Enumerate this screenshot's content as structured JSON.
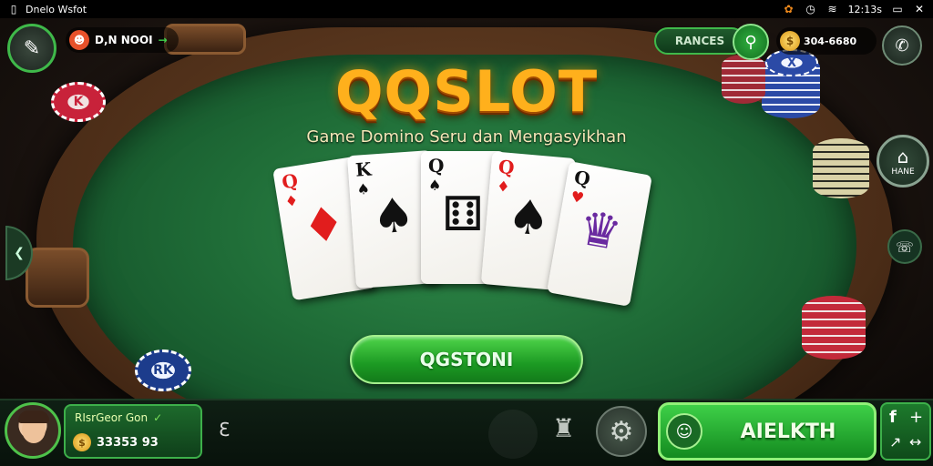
{
  "status_bar": {
    "app_title": "Dnelo Wsfot",
    "time": "12:13s"
  },
  "header": {
    "player_name": "D,N NOOI",
    "rank_label": "RANCES",
    "coins": "304-6680"
  },
  "logo": {
    "text": "QQSLOT",
    "tagline": "Game Domino Seru dan Mengasyikhan"
  },
  "cards": [
    {
      "rank": "Q",
      "suit": "♦",
      "color": "red"
    },
    {
      "rank": "K",
      "suit": "♠",
      "color": "black"
    },
    {
      "rank": "Q",
      "suit": "♠",
      "color": "black"
    },
    {
      "rank": "Q",
      "suit": "♠",
      "color": "red"
    },
    {
      "rank": "Q",
      "suit": "♥",
      "color": "red"
    }
  ],
  "chips": {
    "left_chip_label": "K",
    "bottom_chip_label": "RK",
    "right_chip_label": "X"
  },
  "main_button": {
    "label": "QGSTONI"
  },
  "side": {
    "home_label": "HANE"
  },
  "bottom": {
    "profile_name": "RIsrGeor Gon",
    "profile_balance": "33353 93",
    "mid_icon_label": "Ɛ",
    "action_label": "AIELKTH"
  },
  "colors": {
    "felt": "#1f6c37",
    "accent_green": "#2eb83a",
    "logo_gold": "#ffb01c",
    "wood": "#4a2c17"
  }
}
